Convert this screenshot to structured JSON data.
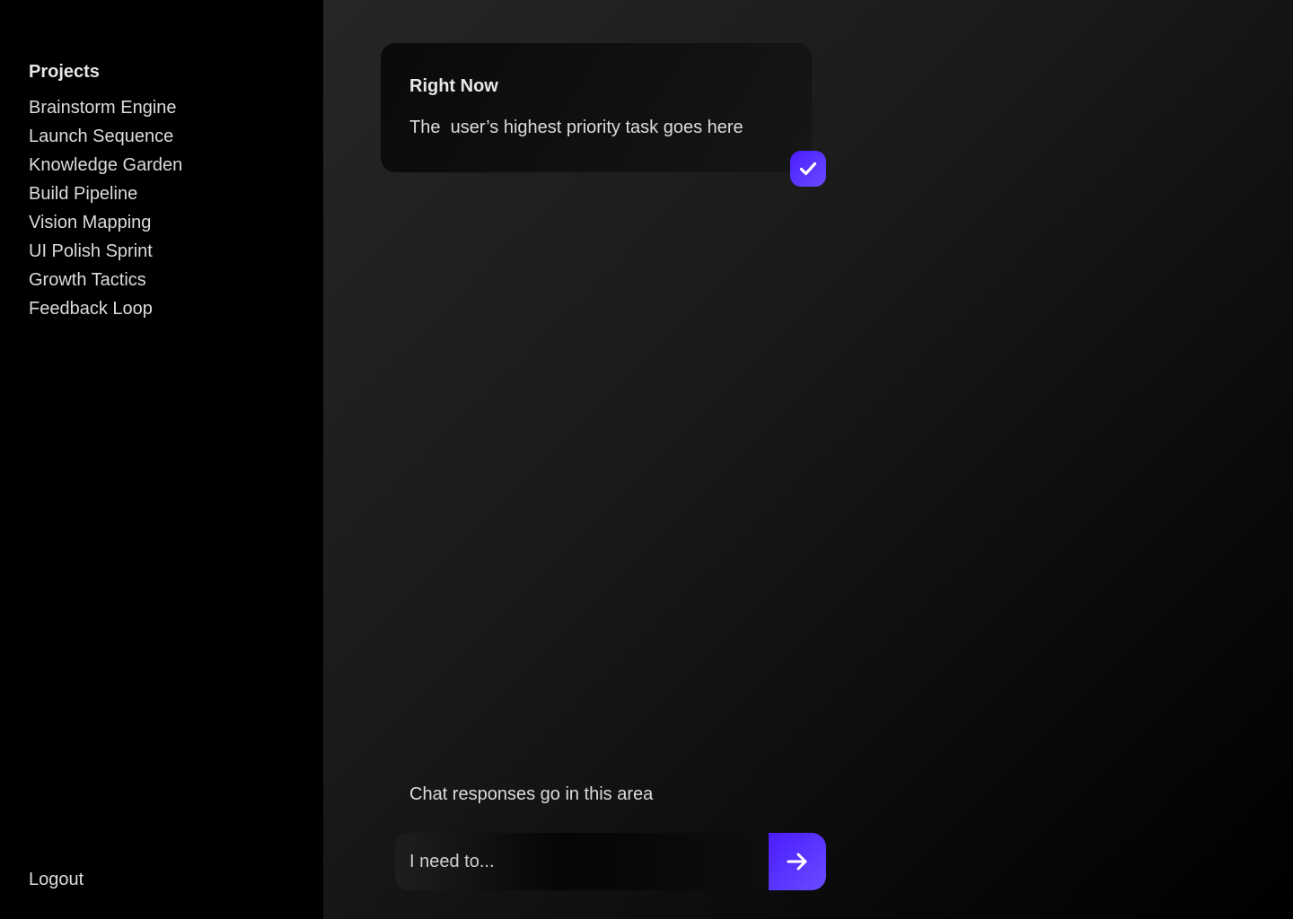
{
  "sidebar": {
    "heading": "Projects",
    "items": [
      {
        "label": "Brainstorm Engine"
      },
      {
        "label": "Launch Sequence"
      },
      {
        "label": "Knowledge Garden"
      },
      {
        "label": "Build Pipeline"
      },
      {
        "label": "Vision Mapping"
      },
      {
        "label": "UI Polish Sprint"
      },
      {
        "label": "Growth Tactics"
      },
      {
        "label": "Feedback Loop"
      }
    ],
    "logout_label": "Logout"
  },
  "task_card": {
    "title": "Right Now",
    "text": "The  user’s highest priority task goes here",
    "complete_icon": "check-icon"
  },
  "chat": {
    "response_text": "Chat responses go in this area",
    "input_placeholder": "I need to...",
    "input_value": "",
    "send_icon": "arrow-right-icon"
  },
  "colors": {
    "accent": "#5a33ff",
    "sidebar_bg": "#000000",
    "text": "#dcdcdc"
  }
}
